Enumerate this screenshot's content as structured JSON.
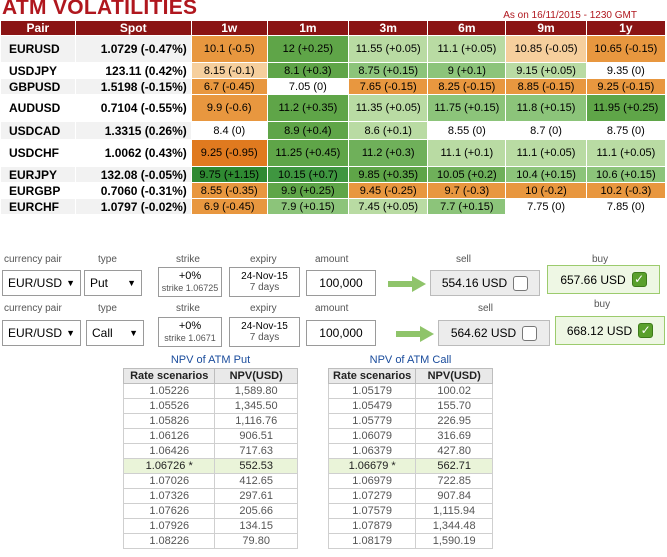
{
  "header": {
    "title": "ATM VOLATILITIES",
    "asof": "As on 16/11/2015 - 1230 GMT"
  },
  "vol_table": {
    "columns": [
      "Pair",
      "Spot",
      "1w",
      "1m",
      "3m",
      "6m",
      "9m",
      "1y"
    ],
    "rows": [
      {
        "pair": "EURUSD",
        "spot": "1.0729 (-0.47%)",
        "cells": [
          "10.1 (-0.5)",
          "12 (+0.25)",
          "11.55 (+0.05)",
          "11.1 (+0.05)",
          "10.85 (-0.05)",
          "10.65 (-0.15)"
        ],
        "colors": [
          "#e8973f",
          "#5fa548",
          "#b9dba3",
          "#b9dba3",
          "#f6cf9d",
          "#e8973f"
        ]
      },
      {
        "pair": "USDJPY",
        "spot": "123.11 (0.42%)",
        "cells": [
          "8.15 (-0.1)",
          "8.1 (+0.3)",
          "8.75 (+0.15)",
          "9 (+0.1)",
          "9.15 (+0.05)",
          "9.35 (0)"
        ],
        "colors": [
          "#f6cf9d",
          "#5fa548",
          "#8cc47a",
          "#8cc47a",
          "#b9dba3",
          "#ffffff"
        ]
      },
      {
        "pair": "GBPUSD",
        "spot": "1.5198 (-0.15%)",
        "cells": [
          "6.7 (-0.45)",
          "7.05 (0)",
          "7.65 (-0.15)",
          "8.25 (-0.15)",
          "8.85 (-0.15)",
          "9.25 (-0.15)"
        ],
        "colors": [
          "#e8973f",
          "#ffffff",
          "#e8973f",
          "#e8973f",
          "#e8973f",
          "#e8973f"
        ]
      },
      {
        "pair": "AUDUSD",
        "spot": "0.7104 (-0.55%)",
        "cells": [
          "9.9 (-0.6)",
          "11.2 (+0.35)",
          "11.35 (+0.05)",
          "11.75 (+0.15)",
          "11.8 (+0.15)",
          "11.95 (+0.25)"
        ],
        "colors": [
          "#e8973f",
          "#5fa548",
          "#b9dba3",
          "#8cc47a",
          "#8cc47a",
          "#5fa548"
        ]
      },
      {
        "pair": "USDCAD",
        "spot": "1.3315 (0.26%)",
        "cells": [
          "8.4 (0)",
          "8.9 (+0.4)",
          "8.6 (+0.1)",
          "8.55 (0)",
          "8.7 (0)",
          "8.75 (0)"
        ],
        "colors": [
          "#ffffff",
          "#5fa548",
          "#b9dba3",
          "#ffffff",
          "#ffffff",
          "#ffffff"
        ]
      },
      {
        "pair": "USDCHF",
        "spot": "1.0062 (0.43%)",
        "cells": [
          "9.25 (-0.95)",
          "11.25 (+0.45)",
          "11.2 (+0.3)",
          "11.1 (+0.1)",
          "11.1 (+0.05)",
          "11.1 (+0.05)"
        ],
        "colors": [
          "#e07a1f",
          "#5fa548",
          "#6fb05a",
          "#b9dba3",
          "#b9dba3",
          "#b9dba3"
        ]
      },
      {
        "pair": "EURJPY",
        "spot": "132.08 (-0.05%)",
        "cells": [
          "9.75 (+1.15)",
          "10.15 (+0.7)",
          "9.85 (+0.35)",
          "10.05 (+0.2)",
          "10.4 (+0.15)",
          "10.6 (+0.15)"
        ],
        "colors": [
          "#2f8a32",
          "#3f9640",
          "#5fa548",
          "#6fb05a",
          "#8cc47a",
          "#8cc47a"
        ]
      },
      {
        "pair": "EURGBP",
        "spot": "0.7060 (-0.31%)",
        "cells": [
          "8.55 (-0.35)",
          "9.9 (+0.25)",
          "9.45 (-0.25)",
          "9.7 (-0.3)",
          "10 (-0.2)",
          "10.2 (-0.3)"
        ],
        "colors": [
          "#e8973f",
          "#5fa548",
          "#e8973f",
          "#e8973f",
          "#e8973f",
          "#e8973f"
        ]
      },
      {
        "pair": "EURCHF",
        "spot": "1.0797 (-0.02%)",
        "cells": [
          "6.9 (-0.45)",
          "7.9 (+0.15)",
          "7.45 (+0.05)",
          "7.7 (+0.15)",
          "7.75 (0)",
          "7.85 (0)"
        ],
        "colors": [
          "#e8973f",
          "#8cc47a",
          "#b9dba3",
          "#8cc47a",
          "#ffffff",
          "#ffffff"
        ]
      }
    ]
  },
  "pricers": [
    {
      "labels": {
        "pair": "currency pair",
        "type": "type",
        "strike": "strike",
        "expiry": "expiry",
        "amount": "amount",
        "sell": "sell",
        "buy": "buy"
      },
      "pair": "EUR/USD",
      "type": "Put",
      "strike_main": "+0%",
      "strike_sub": "strike 1.06725",
      "expiry_main": "24-Nov-15",
      "expiry_sub": "7 days",
      "amount": "100,000",
      "sell": "554.16 USD",
      "buy": "657.66 USD"
    },
    {
      "labels": {
        "pair": "currency pair",
        "type": "type",
        "strike": "strike",
        "expiry": "expiry",
        "amount": "amount",
        "sell": "sell",
        "buy": "buy"
      },
      "pair": "EUR/USD",
      "type": "Call",
      "strike_main": "+0%",
      "strike_sub": "strike 1.0671",
      "expiry_main": "24-Nov-15",
      "expiry_sub": "7 days",
      "amount": "100,000",
      "sell": "564.62 USD",
      "buy": "668.12 USD"
    }
  ],
  "npv_put": {
    "title": "NPV of ATM Put",
    "headers": [
      "Rate scenarios",
      "NPV(USD)"
    ],
    "rows": [
      [
        "1.05226",
        "1,589.80"
      ],
      [
        "1.05526",
        "1,345.50"
      ],
      [
        "1.05826",
        "1,116.76"
      ],
      [
        "1.06126",
        "906.51"
      ],
      [
        "1.06426",
        "717.63"
      ],
      [
        "1.06726 *",
        "552.53"
      ],
      [
        "1.07026",
        "412.65"
      ],
      [
        "1.07326",
        "297.61"
      ],
      [
        "1.07626",
        "205.66"
      ],
      [
        "1.07926",
        "134.15"
      ],
      [
        "1.08226",
        "79.80"
      ]
    ],
    "atm_index": 5
  },
  "npv_call": {
    "title": "NPV of ATM Call",
    "headers": [
      "Rate scenarios",
      "NPV(USD)"
    ],
    "rows": [
      [
        "1.05179",
        "100.02"
      ],
      [
        "1.05479",
        "155.70"
      ],
      [
        "1.05779",
        "226.95"
      ],
      [
        "1.06079",
        "316.69"
      ],
      [
        "1.06379",
        "427.80"
      ],
      [
        "1.06679 *",
        "562.71"
      ],
      [
        "1.06979",
        "722.85"
      ],
      [
        "1.07279",
        "907.84"
      ],
      [
        "1.07579",
        "1,115.94"
      ],
      [
        "1.07879",
        "1,344.48"
      ],
      [
        "1.08179",
        "1,590.19"
      ]
    ],
    "atm_index": 5
  }
}
